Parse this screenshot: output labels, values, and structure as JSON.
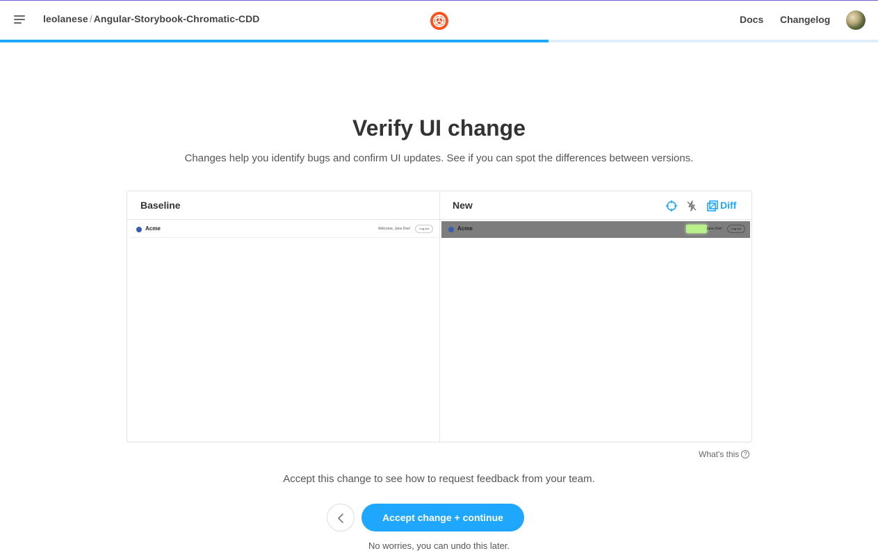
{
  "header": {
    "repo_owner": "leolanese",
    "repo_separator": "/",
    "repo_name": "Angular-Storybook-Chromatic-CDD",
    "nav": {
      "docs": "Docs",
      "changelog": "Changelog"
    },
    "icons": {
      "menu": "menu-icon",
      "logo": "chromatic-logo-icon",
      "avatar": "user-avatar"
    }
  },
  "progress": {
    "fraction": 0.625
  },
  "main": {
    "title": "Verify UI change",
    "subtitle": "Changes help you identify bugs and confirm UI updates. See if you can spot the differences between versions."
  },
  "comparison": {
    "baseline_label": "Baseline",
    "new_label": "New",
    "tools": {
      "focus_icon": "crosshair-icon",
      "strobe_icon": "strobe-off-icon",
      "diff_icon": "diff-icon",
      "diff_label": "Diff"
    },
    "baseline_snapshot": {
      "brand": "Acme",
      "welcome": "Welcome, Jane Doe!",
      "logout": "Log out"
    },
    "new_snapshot": {
      "brand": "Acme",
      "welcome": "Jane Doe!",
      "logout": "Log out"
    }
  },
  "help": {
    "whats_this": "What's this",
    "icon": "question-circle-icon"
  },
  "footer": {
    "accept_text": "Accept this change to see how to request feedback from your team.",
    "back_icon": "chevron-left-icon",
    "accept_button": "Accept change + continue",
    "undo_text": "No worries, you can undo this later."
  },
  "colors": {
    "accent": "#1ea7fd",
    "brand_orange": "#fc521f",
    "progress_track": "#ddeefc",
    "diff_highlight": "#b9f08a"
  }
}
